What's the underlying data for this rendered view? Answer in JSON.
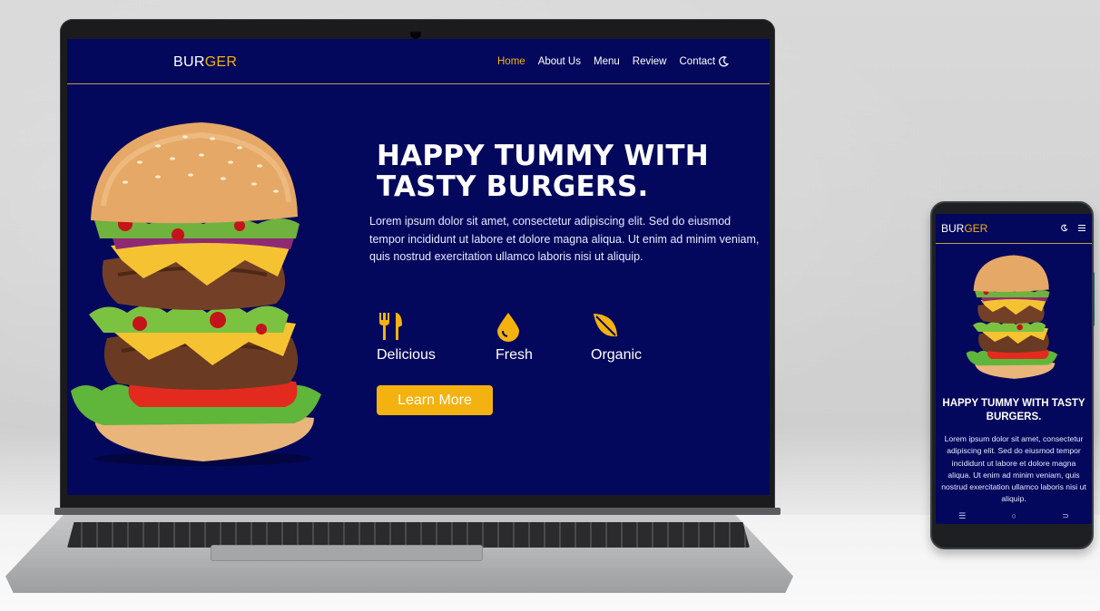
{
  "laptop_site": {
    "logo": {
      "part1": "BUR",
      "part2": "GER"
    },
    "nav": [
      {
        "label": "Home",
        "active": true
      },
      {
        "label": "About Us",
        "active": false
      },
      {
        "label": "Menu",
        "active": false
      },
      {
        "label": "Review",
        "active": false
      },
      {
        "label": "Contact",
        "active": false
      }
    ],
    "theme_icon": "moon-icon",
    "hero": {
      "title_line1": "HAPPY TUMMY WITH",
      "title_line2": "TASTY BURGERS.",
      "text": "Lorem ipsum dolor sit amet, consectetur adipiscing elit. Sed do eiusmod tempor incididunt ut labore et dolore magna aliqua. Ut enim ad minim veniam, quis nostrud exercitation ullamco laboris nisi ut aliquip.",
      "features": [
        {
          "icon": "fork-knife-icon",
          "label": "Delicious"
        },
        {
          "icon": "droplet-icon",
          "label": "Fresh"
        },
        {
          "icon": "leaf-icon",
          "label": "Organic"
        }
      ],
      "button_label": "Learn More"
    }
  },
  "phone_site": {
    "logo": {
      "part1": "BUR",
      "part2": "GER"
    },
    "icons": [
      "moon-icon",
      "menu-icon"
    ],
    "title": "HAPPY TUMMY WITH TASTY BURGERS.",
    "text": "Lorem ipsum dolor sit amet, consectetur adipiscing elit. Sed do eiusmod tempor incididunt ut labore et dolore magna aliqua. Ut enim ad minim veniam, quis nostrud exercitation ullamco laboris nisi ut aliquip.",
    "system_nav": {
      "recent": "☰",
      "home": "○",
      "back": "⊃"
    }
  },
  "colors": {
    "brand_navy": "#03085c",
    "accent_yellow": "#f3b20f"
  }
}
